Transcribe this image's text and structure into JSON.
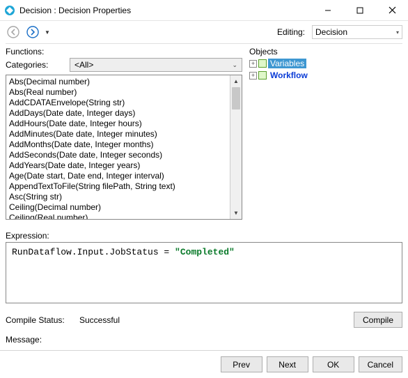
{
  "window": {
    "title": "Decision : Decision Properties"
  },
  "toolbar": {
    "editing_label": "Editing:",
    "editing_value": "Decision"
  },
  "functions": {
    "title": "Functions:",
    "categories_label": "Categories:",
    "categories_value": "<All>",
    "items": [
      "Abs(Decimal number)",
      "Abs(Real number)",
      "AddCDATAEnvelope(String str)",
      "AddDays(Date date, Integer days)",
      "AddHours(Date date, Integer hours)",
      "AddMinutes(Date date, Integer minutes)",
      "AddMonths(Date date, Integer months)",
      "AddSeconds(Date date, Integer seconds)",
      "AddYears(Date date, Integer years)",
      "Age(Date start, Date end, Integer interval)",
      "AppendTextToFile(String filePath, String text)",
      "Asc(String str)",
      "Ceiling(Decimal number)",
      "Ceiling(Real number)"
    ]
  },
  "objects": {
    "title": "Objects",
    "nodes": [
      {
        "label": "Variables",
        "selected": true
      },
      {
        "label": "Workflow",
        "selected": false
      }
    ]
  },
  "expression": {
    "label": "Expression:",
    "prefix": "RunDataflow.Input.JobStatus = ",
    "string": "\"Completed\""
  },
  "status": {
    "compile_status_label": "Compile Status:",
    "compile_status_value": "Successful",
    "message_label": "Message:",
    "message_value": "",
    "compile_button": "Compile"
  },
  "footer": {
    "prev": "Prev",
    "next": "Next",
    "ok": "OK",
    "cancel": "Cancel"
  }
}
